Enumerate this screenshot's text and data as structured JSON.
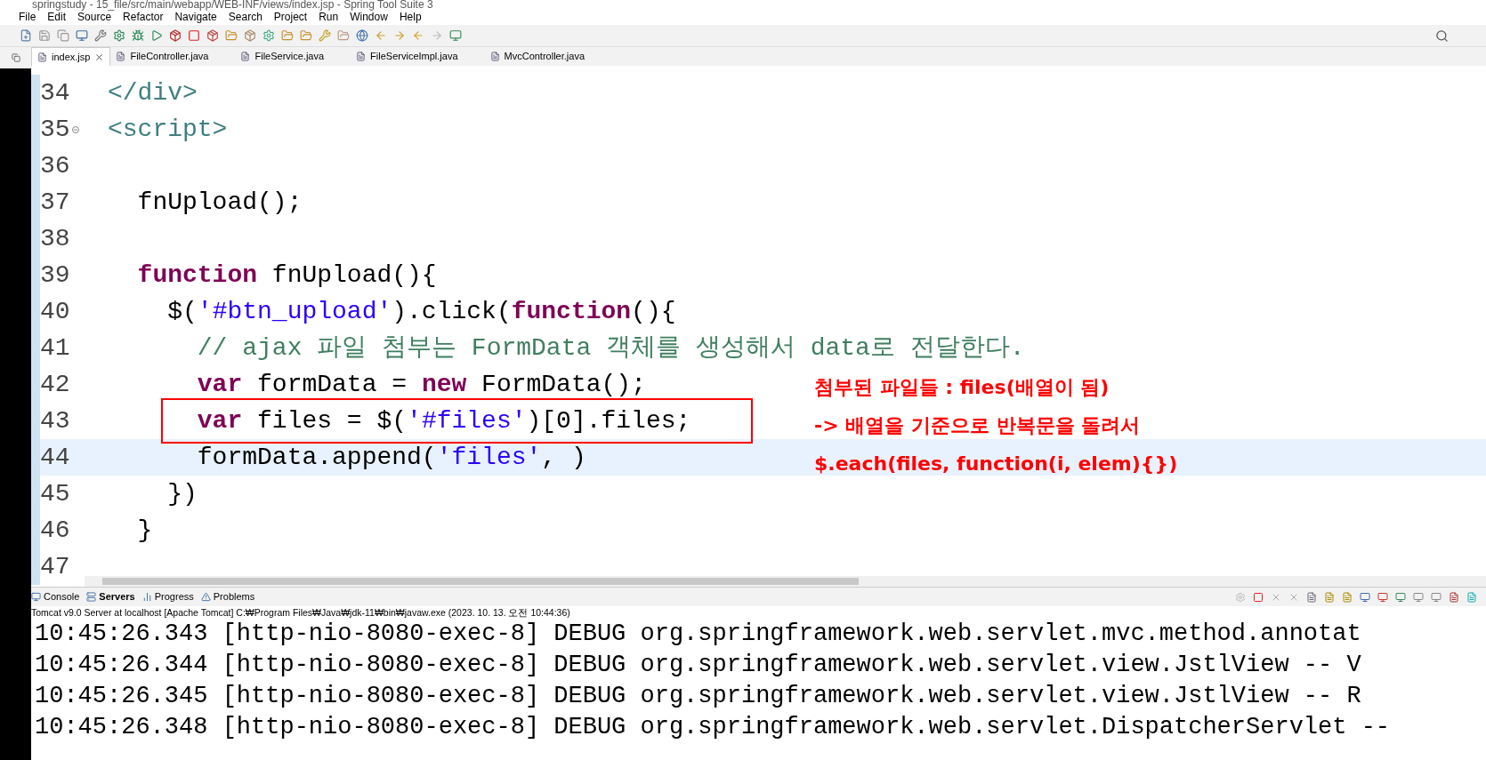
{
  "window": {
    "title": "springstudy - 15_file/src/main/webapp/WEB-INF/views/index.jsp - Spring Tool Suite 3"
  },
  "menu": [
    "File",
    "Edit",
    "Source",
    "Refactor",
    "Navigate",
    "Search",
    "Project",
    "Run",
    "Window",
    "Help"
  ],
  "editor_tabs": [
    {
      "label": "index.jsp",
      "selected": true
    },
    {
      "label": "FileController.java",
      "selected": false
    },
    {
      "label": "FileService.java",
      "selected": false
    },
    {
      "label": "FileServiceImpl.java",
      "selected": false
    },
    {
      "label": "MvcController.java",
      "selected": false
    }
  ],
  "code_lines": [
    {
      "number": "34",
      "current": false,
      "segments": [
        {
          "kind": "tag",
          "text": "</div>"
        }
      ]
    },
    {
      "number": "35",
      "current": false,
      "folding": true,
      "segments": [
        {
          "kind": "tag",
          "text": "<script>"
        }
      ]
    },
    {
      "number": "36",
      "current": false
    },
    {
      "number": "37",
      "current": false,
      "segments": [
        {
          "kind": "plain",
          "text": "  fnUpload();"
        }
      ]
    },
    {
      "number": "38",
      "current": false
    },
    {
      "number": "39",
      "current": false,
      "segments": [
        {
          "kind": "keyword",
          "text": "  function"
        },
        {
          "kind": "plain",
          "text": " fnUpload(){"
        }
      ]
    },
    {
      "number": "40",
      "current": false,
      "segments": [
        {
          "kind": "plain",
          "text": "    $("
        },
        {
          "kind": "string",
          "text": "'#btn_upload'"
        },
        {
          "kind": "plain",
          "text": ").click("
        },
        {
          "kind": "keyword",
          "text": "function"
        },
        {
          "kind": "plain",
          "text": "(){"
        }
      ]
    },
    {
      "number": "41",
      "current": false,
      "segments": [
        {
          "kind": "comment",
          "text": "      // ajax 파일 첨부는 FormData 객체를 생성해서 data로 전달한다."
        }
      ]
    },
    {
      "number": "42",
      "current": false,
      "segments": [
        {
          "kind": "keyword",
          "text": "      var"
        },
        {
          "kind": "plain",
          "text": " formData = "
        },
        {
          "kind": "keyword",
          "text": "new"
        },
        {
          "kind": "plain",
          "text": " FormData();"
        }
      ]
    },
    {
      "number": "43",
      "current": false,
      "boxed": true,
      "segments": [
        {
          "kind": "keyword",
          "text": "      var"
        },
        {
          "kind": "plain",
          "text": " files = $("
        },
        {
          "kind": "string",
          "text": "'#files'"
        },
        {
          "kind": "plain",
          "text": ")[0].files;"
        }
      ]
    },
    {
      "number": "44",
      "current": true,
      "segments": [
        {
          "kind": "plain",
          "text": "      formData.append("
        },
        {
          "kind": "string",
          "text": "'files'"
        },
        {
          "kind": "plain",
          "text": ", )"
        }
      ]
    },
    {
      "number": "45",
      "current": false,
      "segments": [
        {
          "kind": "plain",
          "text": "    })"
        }
      ]
    },
    {
      "number": "46",
      "current": false,
      "segments": [
        {
          "kind": "plain",
          "text": "  }"
        }
      ]
    },
    {
      "number": "47",
      "current": false
    }
  ],
  "annotation": [
    "첨부된 파일들 : files(배열이 됨)",
    "-> 배열을 기준으로 반복문을 돌려서",
    "$.each(files, function(i, elem){})"
  ],
  "console_tabs": [
    {
      "label": "Console",
      "selected": false
    },
    {
      "label": "Servers",
      "selected": true
    },
    {
      "label": "Progress",
      "selected": false
    },
    {
      "label": "Problems",
      "selected": false
    }
  ],
  "console_info": "Tomcat v9.0 Server at localhost [Apache Tomcat] C:₩Program Files₩Java₩jdk-11₩bin₩javaw.exe  (2023. 10. 13. 오전 10:44:36)",
  "console_lines": [
    "10:45:26.343 [http-nio-8080-exec-8] DEBUG org.springframework.web.servlet.mvc.method.annotat",
    "10:45:26.344 [http-nio-8080-exec-8] DEBUG org.springframework.web.servlet.view.JstlView -- V",
    "10:45:26.345 [http-nio-8080-exec-8] DEBUG org.springframework.web.servlet.view.JstlView -- R",
    "10:45:26.348 [http-nio-8080-exec-8] DEBUG org.springframework.web.servlet.DispatcherServlet --"
  ]
}
